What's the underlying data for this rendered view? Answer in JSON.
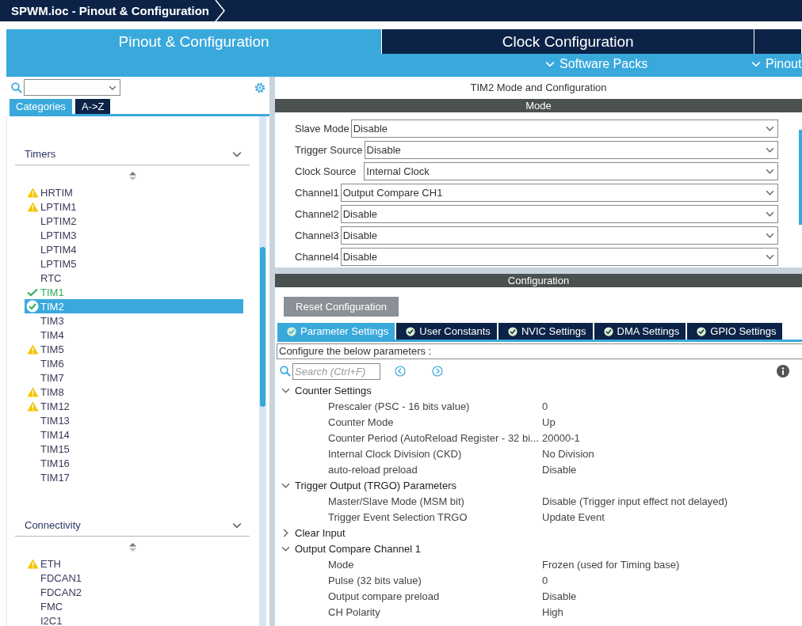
{
  "window": {
    "title": "SPWM.ioc - Pinout & Configuration"
  },
  "main_tabs": [
    {
      "label": "Pinout & Configuration",
      "selected": true
    },
    {
      "label": "Clock Configuration",
      "selected": false
    },
    {
      "selected": false
    }
  ],
  "sub_menu": [
    {
      "label": "Software Packs"
    },
    {
      "label": "Pinout"
    }
  ],
  "sidebar": {
    "view_tabs": [
      {
        "label": "Categories",
        "selected": true
      },
      {
        "label": "A->Z",
        "selected": false
      }
    ],
    "groups": [
      {
        "label": "Timers",
        "items": [
          {
            "label": "HRTIM",
            "kind": "warning",
            "selected": false
          },
          {
            "label": "LPTIM1",
            "kind": "warning",
            "selected": false
          },
          {
            "label": "LPTIM2",
            "kind": "plain",
            "selected": false
          },
          {
            "label": "LPTIM3",
            "kind": "plain",
            "selected": false
          },
          {
            "label": "LPTIM4",
            "kind": "plain",
            "selected": false
          },
          {
            "label": "LPTIM5",
            "kind": "plain",
            "selected": false
          },
          {
            "label": "RTC",
            "kind": "plain",
            "selected": false
          },
          {
            "label": "TIM1",
            "kind": "ok",
            "selected": false
          },
          {
            "label": "TIM2",
            "kind": "ok",
            "selected": true
          },
          {
            "label": "TIM3",
            "kind": "plain",
            "selected": false
          },
          {
            "label": "TIM4",
            "kind": "plain",
            "selected": false
          },
          {
            "label": "TIM5",
            "kind": "warning",
            "selected": false
          },
          {
            "label": "TIM6",
            "kind": "plain",
            "selected": false
          },
          {
            "label": "TIM7",
            "kind": "plain",
            "selected": false
          },
          {
            "label": "TIM8",
            "kind": "warning",
            "selected": false
          },
          {
            "label": "TIM12",
            "kind": "warning",
            "selected": false
          },
          {
            "label": "TIM13",
            "kind": "plain",
            "selected": false
          },
          {
            "label": "TIM14",
            "kind": "plain",
            "selected": false
          },
          {
            "label": "TIM15",
            "kind": "plain",
            "selected": false
          },
          {
            "label": "TIM16",
            "kind": "plain",
            "selected": false
          },
          {
            "label": "TIM17",
            "kind": "plain",
            "selected": false
          }
        ]
      },
      {
        "label": "Connectivity",
        "items": [
          {
            "label": "ETH",
            "kind": "warning",
            "selected": false
          },
          {
            "label": "FDCAN1",
            "kind": "plain",
            "selected": false
          },
          {
            "label": "FDCAN2",
            "kind": "plain",
            "selected": false
          },
          {
            "label": "FMC",
            "kind": "plain",
            "selected": false
          },
          {
            "label": "I2C1",
            "kind": "plain",
            "selected": false
          }
        ]
      }
    ]
  },
  "panel": {
    "title": "TIM2 Mode and Configuration",
    "mode_header": "Mode",
    "mode_fields": [
      {
        "label": "Slave Mode",
        "value": "Disable"
      },
      {
        "label": "Trigger Source",
        "value": "Disable"
      },
      {
        "label": "Clock Source",
        "value": "Internal Clock"
      },
      {
        "label": "Channel1",
        "value": "Output Compare CH1"
      },
      {
        "label": "Channel2",
        "value": "Disable"
      },
      {
        "label": "Channel3",
        "value": "Disable"
      },
      {
        "label": "Channel4",
        "value": "Disable"
      }
    ],
    "config_header": "Configuration",
    "reset_button": "Reset Configuration",
    "config_tabs": [
      {
        "label": "Parameter Settings",
        "selected": true
      },
      {
        "label": "User Constants",
        "selected": false
      },
      {
        "label": "NVIC Settings",
        "selected": false
      },
      {
        "label": "DMA Settings",
        "selected": false
      },
      {
        "label": "GPIO Settings",
        "selected": false
      }
    ],
    "hint": "Configure the below parameters :",
    "search": {
      "placeholder": "Search (Ctrl+F)"
    },
    "parameters": [
      {
        "label": "Counter Settings",
        "expanded": true,
        "children": [
          {
            "name": "Prescaler (PSC - 16 bits value)",
            "value": "0"
          },
          {
            "name": "Counter Mode",
            "value": "Up"
          },
          {
            "name": "Counter Period (AutoReload Register - 32 bi...",
            "value": "20000-1"
          },
          {
            "name": "Internal Clock Division (CKD)",
            "value": "No Division"
          },
          {
            "name": "auto-reload preload",
            "value": "Disable"
          }
        ]
      },
      {
        "label": "Trigger Output (TRGO) Parameters",
        "expanded": true,
        "children": [
          {
            "name": "Master/Slave Mode (MSM bit)",
            "value": "Disable (Trigger input effect not delayed)"
          },
          {
            "name": "Trigger Event Selection TRGO",
            "value": "Update Event"
          }
        ]
      },
      {
        "label": "Clear Input",
        "expanded": false
      },
      {
        "label": "Output Compare Channel 1",
        "expanded": true,
        "children": [
          {
            "name": "Mode",
            "value": "Frozen (used for Timing base)"
          },
          {
            "name": "Pulse (32 bits value)",
            "value": "0"
          },
          {
            "name": "Output compare preload",
            "value": "Disable"
          },
          {
            "name": "CH Polarity",
            "value": "High"
          }
        ]
      }
    ]
  }
}
